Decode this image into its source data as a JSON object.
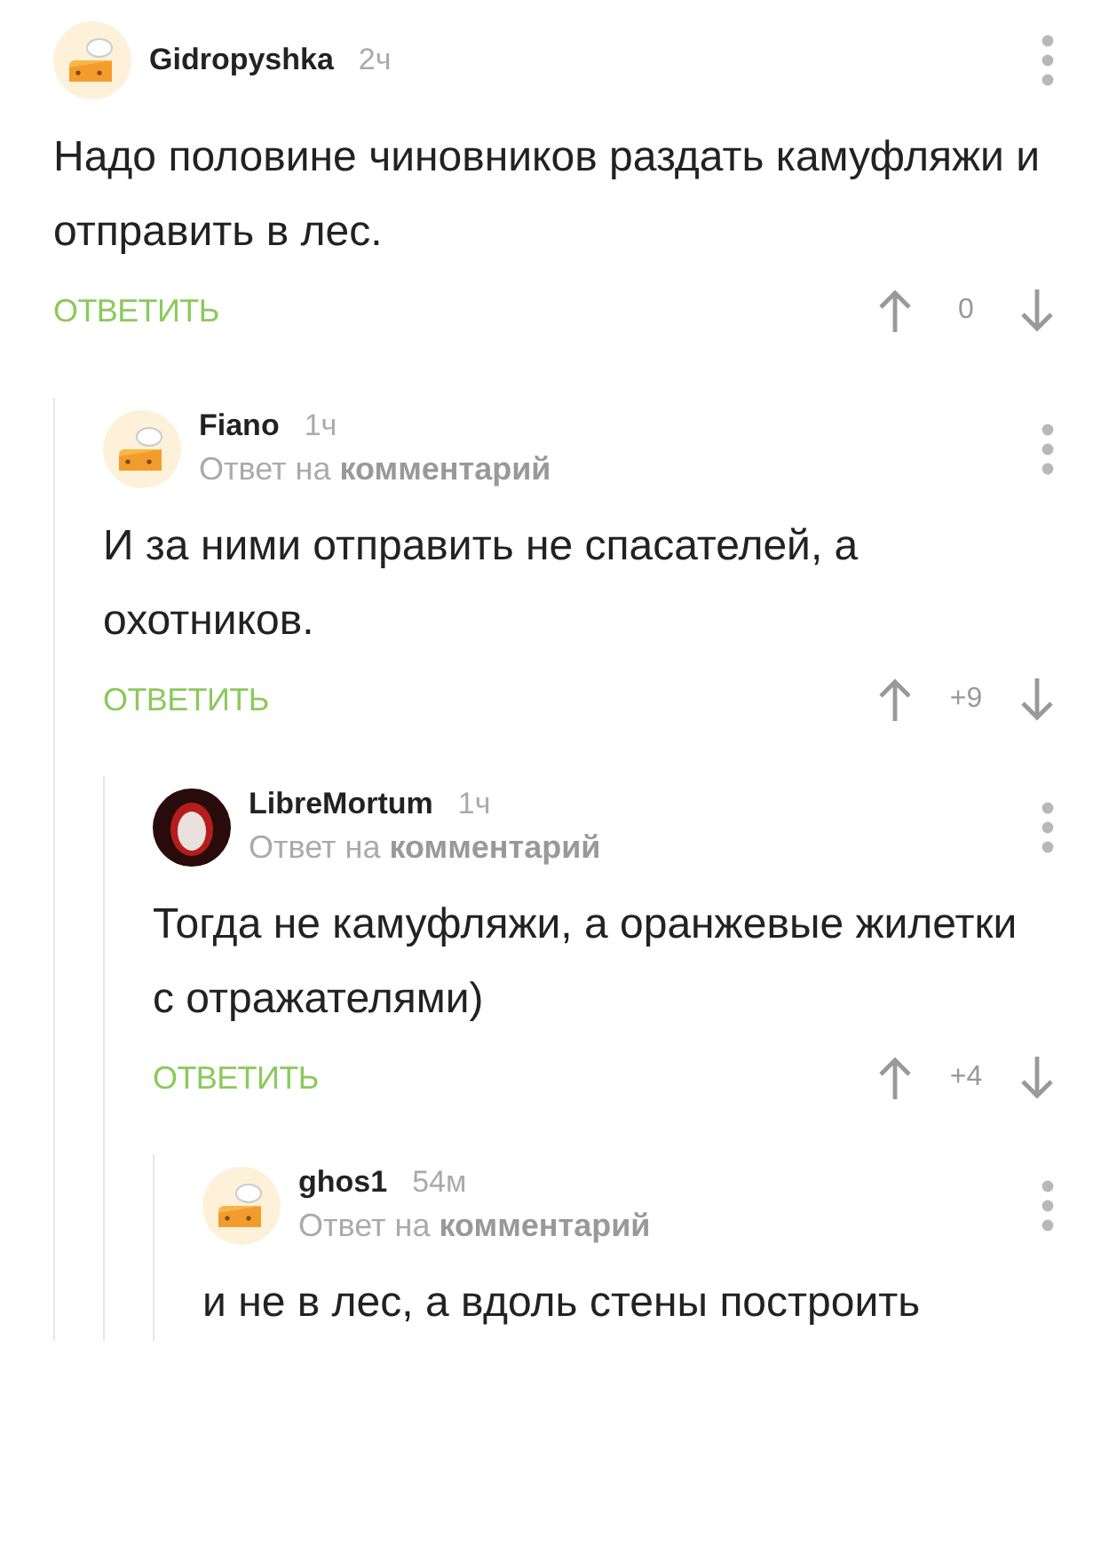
{
  "comments": [
    {
      "author": "Gidropyshka",
      "time": "2ч",
      "avatar": {
        "kind": "default"
      },
      "text": "Надо половине чиновников раздать камуфляжи и отправить в лес.",
      "reply_label": "ОТВЕТИТЬ",
      "score": "0",
      "children": [
        {
          "author": "Fiano",
          "time": "1ч",
          "avatar": {
            "kind": "default"
          },
          "reply_to": {
            "prefix": "Ответ на",
            "link": "комментарий"
          },
          "text": "И за ними отправить не спасателей, а охотников.",
          "reply_label": "ОТВЕТИТЬ",
          "score": "+9",
          "children": [
            {
              "author": "LibreMortum",
              "time": "1ч",
              "avatar": {
                "kind": "custom"
              },
              "reply_to": {
                "prefix": "Ответ на",
                "link": "комментарий"
              },
              "text": "Тогда не камуфляжи, а оранжевые жилетки с отражателями)",
              "reply_label": "ОТВЕТИТЬ",
              "score": "+4",
              "children": [
                {
                  "author": "ghos1",
                  "time": "54м",
                  "avatar": {
                    "kind": "default"
                  },
                  "reply_to": {
                    "prefix": "Ответ на",
                    "link": "комментарий"
                  },
                  "text": "и не в лес, а вдоль стены построить"
                }
              ]
            }
          ]
        }
      ]
    }
  ]
}
